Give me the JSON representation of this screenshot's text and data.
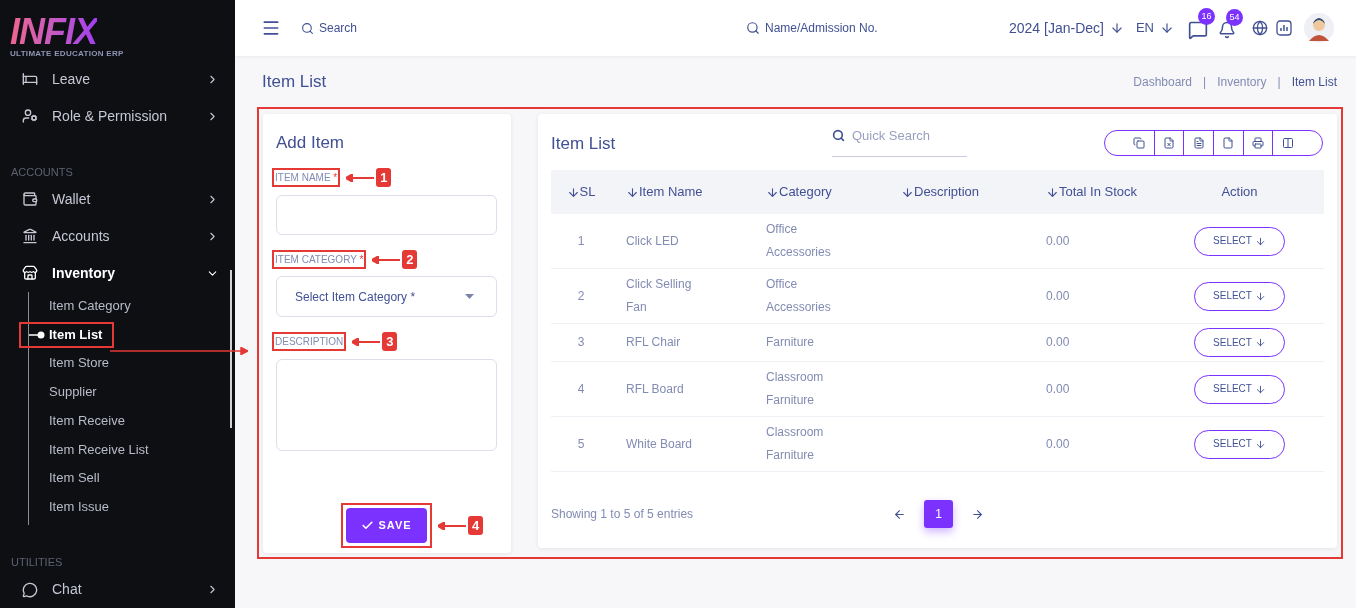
{
  "sidebar": {
    "logo": {
      "wordmark": "INFIX",
      "tagline": "ULTIMATE EDUCATION ERP"
    },
    "items": [
      {
        "kind": "item",
        "label": "Leave",
        "expanded": false
      },
      {
        "kind": "item",
        "label": "Role & Permission",
        "expanded": false
      },
      {
        "kind": "heading",
        "label": "ACCOUNTS"
      },
      {
        "kind": "item",
        "label": "Wallet",
        "expanded": false
      },
      {
        "kind": "item",
        "label": "Accounts",
        "expanded": false
      },
      {
        "kind": "item",
        "label": "Inventory",
        "expanded": true,
        "children": [
          {
            "label": "Item Category",
            "selected": false,
            "callout": false
          },
          {
            "label": "Item List",
            "selected": true,
            "callout": true
          },
          {
            "label": "Item Store",
            "selected": false,
            "callout": false
          },
          {
            "label": "Supplier",
            "selected": false,
            "callout": false
          },
          {
            "label": "Item Receive",
            "selected": false,
            "callout": false
          },
          {
            "label": "Item Receive List",
            "selected": false,
            "callout": false
          },
          {
            "label": "Item Sell",
            "selected": false,
            "callout": false
          },
          {
            "label": "Item Issue",
            "selected": false,
            "callout": false
          }
        ]
      },
      {
        "kind": "heading",
        "label": "UTILITIES"
      },
      {
        "kind": "item",
        "label": "Chat",
        "expanded": false
      }
    ]
  },
  "topbar": {
    "search": {
      "placeholder": "Search"
    },
    "student_search": {
      "placeholder": "Name/Admission No."
    },
    "session": "2024 [Jan-Dec]",
    "language": "EN",
    "message_count": "16",
    "notification_count": "54"
  },
  "page": {
    "title": "Item List",
    "breadcrumb": [
      "Dashboard",
      "Inventory",
      "Item List"
    ],
    "separator": "|"
  },
  "add_item": {
    "title": "Add Item",
    "fields": [
      {
        "kind": "text",
        "label": "ITEM NAME",
        "required_mark": "*",
        "callout": "1"
      },
      {
        "kind": "select",
        "label": "ITEM CATEGORY",
        "required_mark": "*",
        "placeholder": "Select Item Category *",
        "callout": "2"
      },
      {
        "kind": "textarea",
        "label": "DESCRIPTION",
        "callout": "3"
      }
    ],
    "save": {
      "label": "SAVE",
      "callout": "4"
    }
  },
  "item_list": {
    "title": "Item List",
    "search": {
      "placeholder": "Quick Search"
    },
    "columns": [
      "SL",
      "Item Name",
      "Category",
      "Description",
      "Total In Stock",
      "Action"
    ],
    "rows": [
      {
        "sl": "1",
        "item_name": "Click LED",
        "category": "Office Accessories",
        "total_in_stock": "0.00",
        "action": "SELECT"
      },
      {
        "sl": "2",
        "item_name": "Click Selling Fan",
        "category": "Office Accessories",
        "total_in_stock": "0.00",
        "action": "SELECT"
      },
      {
        "sl": "3",
        "item_name": "RFL Chair",
        "category": "Farniture",
        "total_in_stock": "0.00",
        "action": "SELECT"
      },
      {
        "sl": "4",
        "item_name": "RFL Board",
        "category": "Classroom Farniture",
        "total_in_stock": "0.00",
        "action": "SELECT"
      },
      {
        "sl": "5",
        "item_name": "White Board",
        "category": "Classroom Farniture",
        "total_in_stock": "0.00",
        "action": "SELECT"
      }
    ],
    "footer": "Showing 1 to 5 of 5 entries",
    "pages": [
      {
        "label": "1",
        "selected": true
      }
    ]
  }
}
